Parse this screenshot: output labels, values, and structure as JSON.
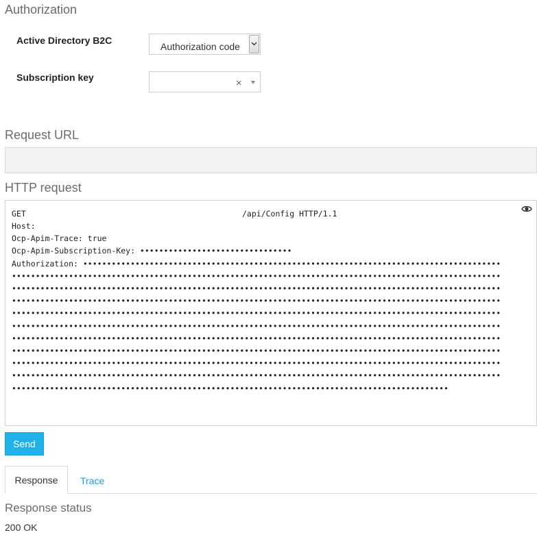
{
  "authorization": {
    "title": "Authorization",
    "active_directory_label": "Active Directory B2C",
    "active_directory_value": "Authorization code",
    "subscription_key_label": "Subscription key",
    "subscription_key_value": "",
    "clear_glyph": "×"
  },
  "request_url": {
    "title": "Request URL",
    "value": ""
  },
  "http_request": {
    "title": "HTTP request",
    "method": "GET",
    "path": "/api/Config HTTP/1.1",
    "lines": [
      "Host:",
      "Ocp-Apim-Trace: true",
      "Ocp-Apim-Subscription-Key: ••••••••••••••••••••••••••••••••",
      "Authorization: ••••••••••••••••••••••••••••••••••••••••••••••••••••••••••••••••••••••••••••••••••••••••",
      "•••••••••••••••••••••••••••••••••••••••••••••••••••••••••••••••••••••••••••••••••••••••••••••••••••••••",
      "•••••••••••••••••••••••••••••••••••••••••••••••••••••••••••••••••••••••••••••••••••••••••••••••••••••••",
      "•••••••••••••••••••••••••••••••••••••••••••••••••••••••••••••••••••••••••••••••••••••••••••••••••••••••",
      "•••••••••••••••••••••••••••••••••••••••••••••••••••••••••••••••••••••••••••••••••••••••••••••••••••••••",
      "•••••••••••••••••••••••••••••••••••••••••••••••••••••••••••••••••••••••••••••••••••••••••••••••••••••••",
      "•••••••••••••••••••••••••••••••••••••••••••••••••••••••••••••••••••••••••••••••••••••••••••••••••••••••",
      "•••••••••••••••••••••••••••••••••••••••••••••••••••••••••••••••••••••••••••••••••••••••••••••••••••••••",
      "•••••••••••••••••••••••••••••••••••••••••••••••••••••••••••••••••••••••••••••••••••••••••••••••••••••••",
      "•••••••••••••••••••••••••••••••••••••••••••••••••••••••••••••••••••••••••••••••••••••••••••••••••••••••",
      "••••••••••••••••••••••••••••••••••••••••••••••••••••••••••••••••••••••••••••••••••••••••••••"
    ],
    "toggle_icon": "eye-icon"
  },
  "actions": {
    "send_label": "Send"
  },
  "tabs": [
    {
      "label": "Response",
      "active": true
    },
    {
      "label": "Trace",
      "active": false
    }
  ],
  "response": {
    "status_title": "Response status",
    "status_value": "200 OK"
  },
  "colors": {
    "accent": "#1eb2e8",
    "link": "#1ba1e2",
    "muted_heading": "#6b6b6b"
  }
}
